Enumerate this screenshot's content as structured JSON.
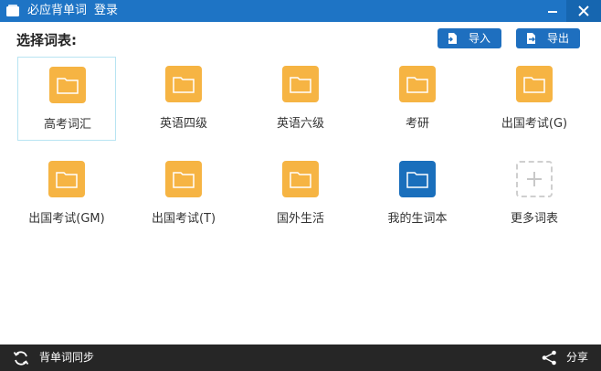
{
  "window": {
    "app_name": "必应背单词",
    "login_label": "登录",
    "minimize_glyph": "–",
    "close_glyph": "✕"
  },
  "header": {
    "title": "选择词表:",
    "import_label": "导入",
    "export_label": "导出"
  },
  "wordlists": [
    {
      "label": "高考词汇",
      "icon": "folder-icon",
      "color": "#f6b443"
    },
    {
      "label": "英语四级",
      "icon": "folder-icon",
      "color": "#f6b443"
    },
    {
      "label": "英语六级",
      "icon": "folder-icon",
      "color": "#f6b443"
    },
    {
      "label": "考研",
      "icon": "folder-icon",
      "color": "#f6b443"
    },
    {
      "label": "出国考试(G)",
      "icon": "folder-icon",
      "color": "#f6b443"
    },
    {
      "label": "出国考试(GM)",
      "icon": "folder-icon",
      "color": "#f6b443"
    },
    {
      "label": "出国考试(T)",
      "icon": "folder-icon",
      "color": "#f6b443"
    },
    {
      "label": "国外生活",
      "icon": "folder-icon",
      "color": "#f6b443"
    },
    {
      "label": "我的生词本",
      "icon": "folder-icon",
      "color": "#1a6fbc"
    },
    {
      "label": "更多词表",
      "icon": "plus-icon",
      "color": "#cfcfcf"
    }
  ],
  "footer": {
    "sync_label": "背单词同步",
    "share_label": "分享"
  },
  "colors": {
    "titlebar": "#1e74c5",
    "button": "#1e6fbf",
    "folder": "#f6b443",
    "footer": "#262626"
  }
}
